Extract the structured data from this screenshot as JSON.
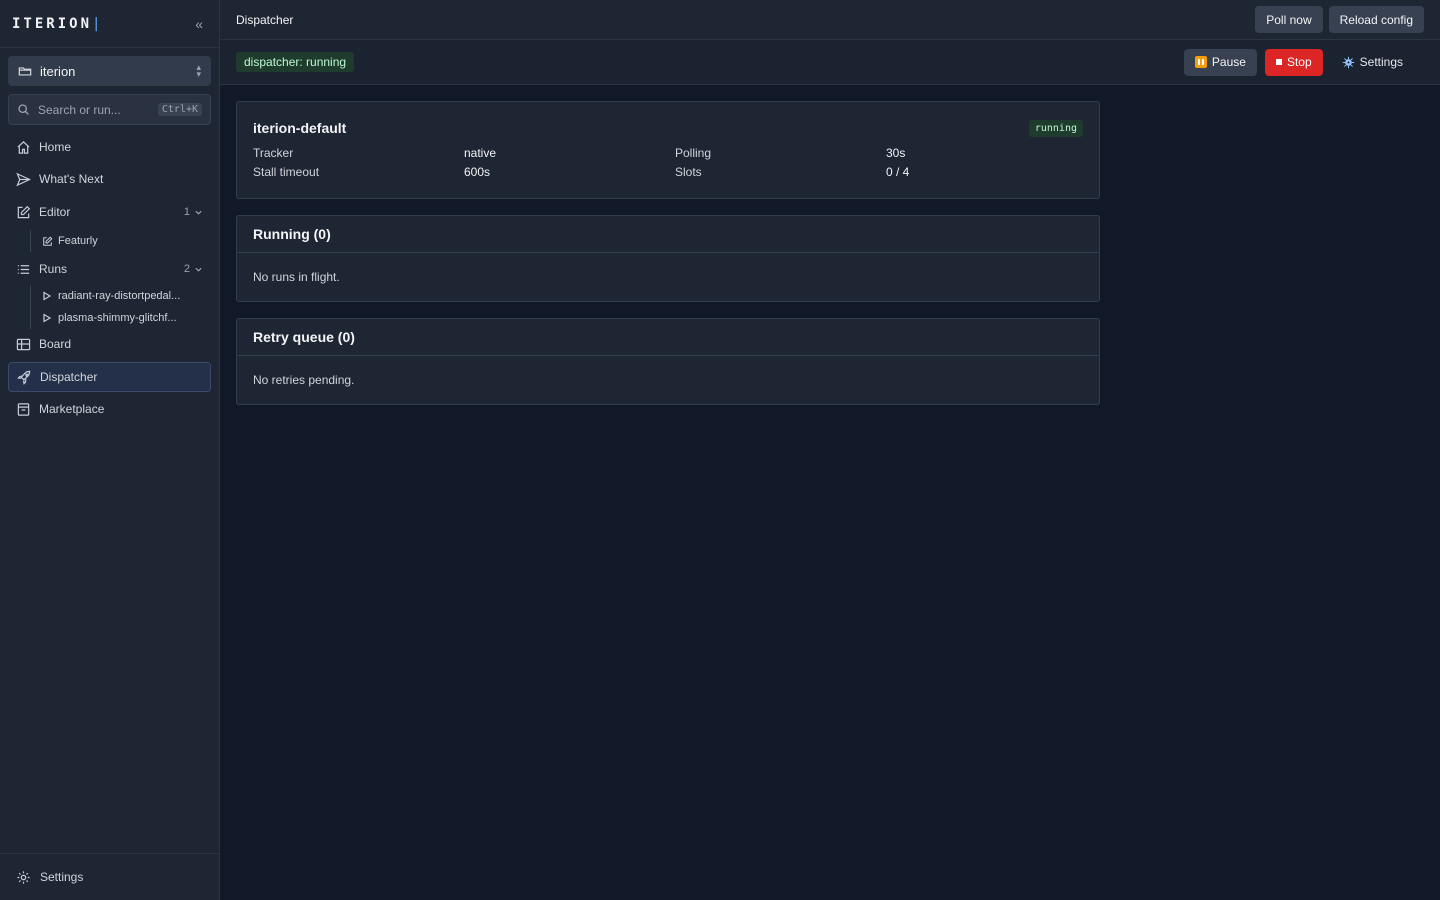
{
  "sidebar": {
    "brand": "ITERION",
    "brand_cursor": "|",
    "collapse_label": "«",
    "project": "iterion",
    "search": {
      "placeholder": "Search or run...",
      "shortcut": "Ctrl+K"
    },
    "nav": {
      "home": "Home",
      "whats_next": "What's Next",
      "editor": {
        "label": "Editor",
        "count": "1"
      },
      "editor_children": [
        "Featurly"
      ],
      "runs": {
        "label": "Runs",
        "count": "2"
      },
      "runs_children": [
        "radiant-ray-distortpedal...",
        "plasma-shimmy-glitchf..."
      ],
      "board": "Board",
      "dispatcher": "Dispatcher",
      "marketplace": "Marketplace"
    },
    "footer": "Settings"
  },
  "topbar": {
    "title": "Dispatcher",
    "poll_now": "Poll now",
    "reload_config": "Reload config"
  },
  "toolbar": {
    "status": "dispatcher: running",
    "pause": "Pause",
    "stop": "Stop",
    "settings": "Settings"
  },
  "config_card": {
    "title": "iterion-default",
    "status": "running",
    "rows": [
      {
        "k1": "Tracker",
        "v1": "native",
        "k2": "Polling",
        "v2": "30s"
      },
      {
        "k1": "Stall timeout",
        "v1": "600s",
        "k2": "Slots",
        "v2": "0 / 4"
      }
    ]
  },
  "running_card": {
    "title": "Running (0)",
    "empty": "No runs in flight."
  },
  "retry_card": {
    "title": "Retry queue (0)",
    "empty": "No retries pending."
  }
}
